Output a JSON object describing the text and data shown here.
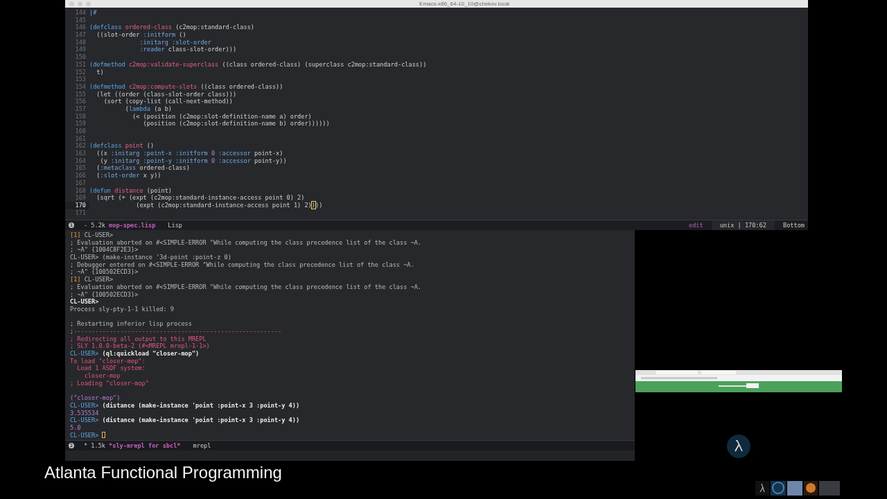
{
  "window": {
    "title": "Emacs-x86_64-10_10@chekov.local"
  },
  "code": {
    "lines": [
      {
        "num": "144",
        "current": false,
        "segs": [
          {
            "kind": "key",
            "text": "|#"
          }
        ]
      },
      {
        "num": "145",
        "current": false
      },
      {
        "num": "146",
        "current": false,
        "segs": [
          {
            "kind": "kw",
            "text": "(defclass "
          },
          {
            "kind": "def",
            "text": "ordered-class"
          },
          {
            "kind": "txt",
            "text": " (c2mop:standard-class)"
          }
        ]
      },
      {
        "num": "147",
        "current": false,
        "segs": [
          {
            "kind": "txt",
            "text": "  ((slot-order "
          },
          {
            "kind": "key",
            "text": ":initform"
          },
          {
            "kind": "txt",
            "text": " ()"
          }
        ]
      },
      {
        "num": "148",
        "current": false,
        "segs": [
          {
            "kind": "key",
            "text": "              :initarg :slot-order"
          }
        ]
      },
      {
        "num": "149",
        "current": false,
        "segs": [
          {
            "kind": "key",
            "text": "              :reader"
          },
          {
            "kind": "txt",
            "text": " class-slot-order)))"
          }
        ]
      },
      {
        "num": "150",
        "current": false
      },
      {
        "num": "151",
        "current": false,
        "segs": [
          {
            "kind": "kw",
            "text": "(defmethod "
          },
          {
            "kind": "def",
            "text": "c2mop:validate-superclass"
          },
          {
            "kind": "txt",
            "text": " ((class ordered-class) (superclass c2mop:standard-class))"
          }
        ]
      },
      {
        "num": "152",
        "current": false,
        "segs": [
          {
            "kind": "txt",
            "text": "  t)"
          }
        ]
      },
      {
        "num": "153",
        "current": false
      },
      {
        "num": "154",
        "current": false,
        "segs": [
          {
            "kind": "kw",
            "text": "(defmethod "
          },
          {
            "kind": "def",
            "text": "c2mop:compute-slots"
          },
          {
            "kind": "txt",
            "text": " ((class ordered-class))"
          }
        ]
      },
      {
        "num": "155",
        "current": false,
        "segs": [
          {
            "kind": "txt",
            "text": "  (let ((order (class-slot-order class)))"
          }
        ]
      },
      {
        "num": "156",
        "current": false,
        "segs": [
          {
            "kind": "txt",
            "text": "    (sort (copy-list (call-next-method))"
          }
        ]
      },
      {
        "num": "157",
        "current": false,
        "segs": [
          {
            "kind": "txt",
            "text": "          ("
          },
          {
            "kind": "kw",
            "text": "lambda"
          },
          {
            "kind": "txt",
            "text": " (a b)"
          }
        ]
      },
      {
        "num": "158",
        "current": false,
        "segs": [
          {
            "kind": "txt",
            "text": "            (< (position (c2mop:slot-definition-name a) order)"
          }
        ]
      },
      {
        "num": "159",
        "current": false,
        "segs": [
          {
            "kind": "txt",
            "text": "               (position (c2mop:slot-definition-name b) order))))))"
          }
        ]
      },
      {
        "num": "160",
        "current": false
      },
      {
        "num": "161",
        "current": false
      },
      {
        "num": "162",
        "current": false,
        "segs": [
          {
            "kind": "kw",
            "text": "(defclass "
          },
          {
            "kind": "def",
            "text": "point"
          },
          {
            "kind": "txt",
            "text": " ()"
          }
        ]
      },
      {
        "num": "163",
        "current": false,
        "segs": [
          {
            "kind": "txt",
            "text": "  ((x "
          },
          {
            "kind": "key",
            "text": ":initarg :point-x :initform "
          },
          {
            "kind": "num",
            "text": "0"
          },
          {
            "kind": "key",
            "text": " :accessor"
          },
          {
            "kind": "txt",
            "text": " point-x)"
          }
        ]
      },
      {
        "num": "164",
        "current": false,
        "segs": [
          {
            "kind": "txt",
            "text": "   (y "
          },
          {
            "kind": "key",
            "text": ":initarg :point-y :initform "
          },
          {
            "kind": "num",
            "text": "0"
          },
          {
            "kind": "key",
            "text": " :accessor"
          },
          {
            "kind": "txt",
            "text": " point-y))"
          }
        ]
      },
      {
        "num": "165",
        "current": false,
        "segs": [
          {
            "kind": "txt",
            "text": "  ("
          },
          {
            "kind": "key",
            "text": ":metaclass"
          },
          {
            "kind": "txt",
            "text": " ordered-class)"
          }
        ]
      },
      {
        "num": "166",
        "current": false,
        "segs": [
          {
            "kind": "txt",
            "text": "  ("
          },
          {
            "kind": "key",
            "text": ":slot-order"
          },
          {
            "kind": "txt",
            "text": " x y))"
          }
        ]
      },
      {
        "num": "167",
        "current": false
      },
      {
        "num": "168",
        "current": false,
        "segs": [
          {
            "kind": "kw",
            "text": "(defun "
          },
          {
            "kind": "def",
            "text": "distance"
          },
          {
            "kind": "txt",
            "text": " (point)"
          }
        ]
      },
      {
        "num": "169",
        "current": false,
        "segs": [
          {
            "kind": "txt",
            "text": "  (sqrt (+ (expt (c2mop:standard-instance-access point 0) 2)"
          }
        ]
      },
      {
        "num": "170",
        "current": true,
        "segs": [
          {
            "kind": "txt",
            "text": "             (expt (c2mop:standard-instance-access point 1) 2)"
          },
          {
            "kind": "cursor",
            "text": ")"
          },
          {
            "kind": "txt",
            "text": "))"
          }
        ]
      },
      {
        "num": "171",
        "current": false
      }
    ]
  },
  "code_modeline": {
    "window_number": "1",
    "size": "- 5.2k",
    "buffer": "mop-spec.lisp",
    "mode": "Lisp",
    "state": "edit",
    "position": "unix | 170:62",
    "scroll": "Bottom"
  },
  "repl": {
    "lines": [
      {
        "segs": [
          {
            "kind": "lvl",
            "text": "[1]"
          },
          {
            "kind": "out",
            "text": " CL-USER>"
          }
        ]
      },
      {
        "segs": [
          {
            "kind": "out",
            "text": "; Evaluation aborted on #<SIMPLE-ERROR \"While computing the class precedence list of the class ~A."
          }
        ]
      },
      {
        "segs": [
          {
            "kind": "out",
            "text": "; ~A\" {1004C8F2E3}>"
          }
        ]
      },
      {
        "segs": [
          {
            "kind": "out",
            "text": "CL-USER> (make-instance '3d-point :point-z 0)"
          }
        ]
      },
      {
        "segs": [
          {
            "kind": "out",
            "text": "; Debugger entered on #<SIMPLE-ERROR \"While computing the class precedence list of the class ~A."
          }
        ]
      },
      {
        "segs": [
          {
            "kind": "out",
            "text": "; ~A\" {100502ECD3}>"
          }
        ]
      },
      {
        "segs": [
          {
            "kind": "lvl",
            "text": "[1]"
          },
          {
            "kind": "out",
            "text": " CL-USER>"
          }
        ]
      },
      {
        "segs": [
          {
            "kind": "out",
            "text": "; Evaluation aborted on #<SIMPLE-ERROR \"While computing the class precedence list of the class ~A."
          }
        ]
      },
      {
        "segs": [
          {
            "kind": "out",
            "text": "; ~A\" {100502ECD3}>"
          }
        ]
      },
      {
        "segs": [
          {
            "kind": "bold",
            "text": "CL-USER>"
          }
        ]
      },
      {
        "segs": [
          {
            "kind": "out",
            "text": "Process sly-pty-1-1 killed: 9"
          }
        ]
      },
      {
        "gap_before": true,
        "segs": [
          {
            "kind": "out",
            "text": "; Restarting inferior lisp process"
          }
        ]
      },
      {
        "segs": [
          {
            "kind": "out",
            "text": ";"
          },
          {
            "kind": "rule",
            "text": "----------------------------------------------------------"
          }
        ]
      },
      {
        "segs": [
          {
            "kind": "pink",
            "text": "; Redirecting all output to this MREPL"
          }
        ]
      },
      {
        "segs": [
          {
            "kind": "pink",
            "text": "; SLY 1.0.0-beta-2 (#<MREPL mrepl-1-1>)"
          }
        ]
      },
      {
        "segs": [
          {
            "kind": "prompt",
            "text": "CL-USER>"
          },
          {
            "kind": "input",
            "text": " (ql:quickload \"closer-mop\")"
          }
        ]
      },
      {
        "segs": [
          {
            "kind": "pink",
            "text": "To load \"closer-mop\":"
          }
        ]
      },
      {
        "segs": [
          {
            "kind": "pink",
            "text": "  Load 1 ASDF system:"
          }
        ]
      },
      {
        "segs": [
          {
            "kind": "pink",
            "text": "    closer-mop"
          }
        ]
      },
      {
        "segs": [
          {
            "kind": "pink",
            "text": "; Loading \"closer-mop\""
          }
        ]
      },
      {
        "gap_before": true,
        "segs": [
          {
            "kind": "num",
            "text": "(\"closer-mop\")"
          }
        ]
      },
      {
        "segs": [
          {
            "kind": "prompt",
            "text": "CL-USER>"
          },
          {
            "kind": "input",
            "text": " (distance (make-instance 'point :point-x 3 :point-y 4))"
          }
        ]
      },
      {
        "segs": [
          {
            "kind": "num",
            "text": "3.535534"
          }
        ]
      },
      {
        "segs": [
          {
            "kind": "prompt",
            "text": "CL-USER>"
          },
          {
            "kind": "input",
            "text": " (distance (make-instance 'point :point-x 3 :point-y 4))"
          }
        ]
      },
      {
        "segs": [
          {
            "kind": "num",
            "text": "5.0"
          }
        ]
      },
      {
        "segs": [
          {
            "kind": "prompt",
            "text": "CL-USER>"
          }
        ],
        "cursor": true
      }
    ]
  },
  "repl_modeline": {
    "window_number": "2",
    "size": "* 1.5k",
    "buffer": "*sly-mrepl for sbcl*",
    "mode": "mrepl"
  },
  "caption": "Atlanta Functional Programming"
}
